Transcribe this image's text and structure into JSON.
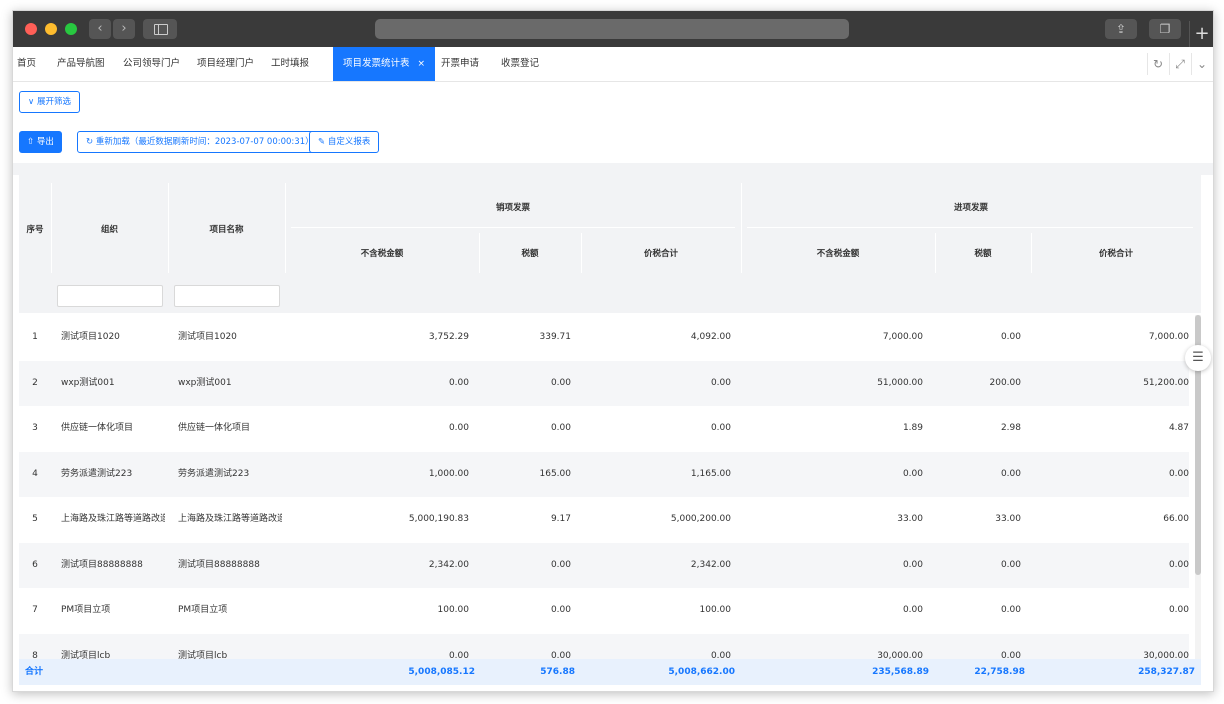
{
  "tabs": [
    {
      "label": "首页"
    },
    {
      "label": "产品导航图"
    },
    {
      "label": "公司领导门户"
    },
    {
      "label": "项目经理门户"
    },
    {
      "label": "工时填报"
    },
    {
      "label": "项目发票统计表",
      "close": "×"
    },
    {
      "label": "开票申请"
    },
    {
      "label": "收票登记"
    }
  ],
  "toolbar": {
    "expand_filter": "展开筛选",
    "export": "导出",
    "reload": "重新加载（最近数据刷新时间：2023-07-07 00:00:31）",
    "custom_report": "自定义报表"
  },
  "table": {
    "headers": {
      "seq": "序号",
      "org": "组织",
      "project": "项目名称",
      "sales_group": "销项发票",
      "input_group": "进项发票",
      "amount_ex_tax": "不含税金额",
      "tax": "税额",
      "total": "价税合计"
    },
    "rows": [
      {
        "seq": "1",
        "org": "测试项目1020",
        "project": "测试项目1020",
        "s_amount": "3,752.29",
        "s_tax": "339.71",
        "s_total": "4,092.00",
        "i_amount": "7,000.00",
        "i_tax": "0.00",
        "i_total": "7,000.00"
      },
      {
        "seq": "2",
        "org": "wxp测试001",
        "project": "wxp测试001",
        "s_amount": "0.00",
        "s_tax": "0.00",
        "s_total": "0.00",
        "i_amount": "51,000.00",
        "i_tax": "200.00",
        "i_total": "51,200.00"
      },
      {
        "seq": "3",
        "org": "供应链一体化项目",
        "project": "供应链一体化项目",
        "s_amount": "0.00",
        "s_tax": "0.00",
        "s_total": "0.00",
        "i_amount": "1.89",
        "i_tax": "2.98",
        "i_total": "4.87"
      },
      {
        "seq": "4",
        "org": "劳务派遣测试223",
        "project": "劳务派遣测试223",
        "s_amount": "1,000.00",
        "s_tax": "165.00",
        "s_total": "1,165.00",
        "i_amount": "0.00",
        "i_tax": "0.00",
        "i_total": "0.00"
      },
      {
        "seq": "5",
        "org": "上海路及珠江路等道路改造",
        "project": "上海路及珠江路等道路改造",
        "s_amount": "5,000,190.83",
        "s_tax": "9.17",
        "s_total": "5,000,200.00",
        "i_amount": "33.00",
        "i_tax": "33.00",
        "i_total": "66.00"
      },
      {
        "seq": "6",
        "org": "测试项目88888888",
        "project": "测试项目88888888",
        "s_amount": "2,342.00",
        "s_tax": "0.00",
        "s_total": "2,342.00",
        "i_amount": "0.00",
        "i_tax": "0.00",
        "i_total": "0.00"
      },
      {
        "seq": "7",
        "org": "PM项目立项",
        "project": "PM项目立项",
        "s_amount": "100.00",
        "s_tax": "0.00",
        "s_total": "100.00",
        "i_amount": "0.00",
        "i_tax": "0.00",
        "i_total": "0.00"
      },
      {
        "seq": "8",
        "org": "测试项目lcb",
        "project": "测试项目lcb",
        "s_amount": "0.00",
        "s_tax": "0.00",
        "s_total": "0.00",
        "i_amount": "30,000.00",
        "i_tax": "0.00",
        "i_total": "30,000.00"
      }
    ],
    "footer": {
      "label": "合计",
      "s_amount": "5,008,085.12",
      "s_tax": "576.88",
      "s_total": "5,008,662.00",
      "i_amount": "235,568.89",
      "i_tax": "22,758.98",
      "i_total": "258,327.87"
    }
  },
  "colors": {
    "accent": "#1677ff",
    "header_bg": "#f2f3f5",
    "footer_bg": "#e8f1fd"
  }
}
